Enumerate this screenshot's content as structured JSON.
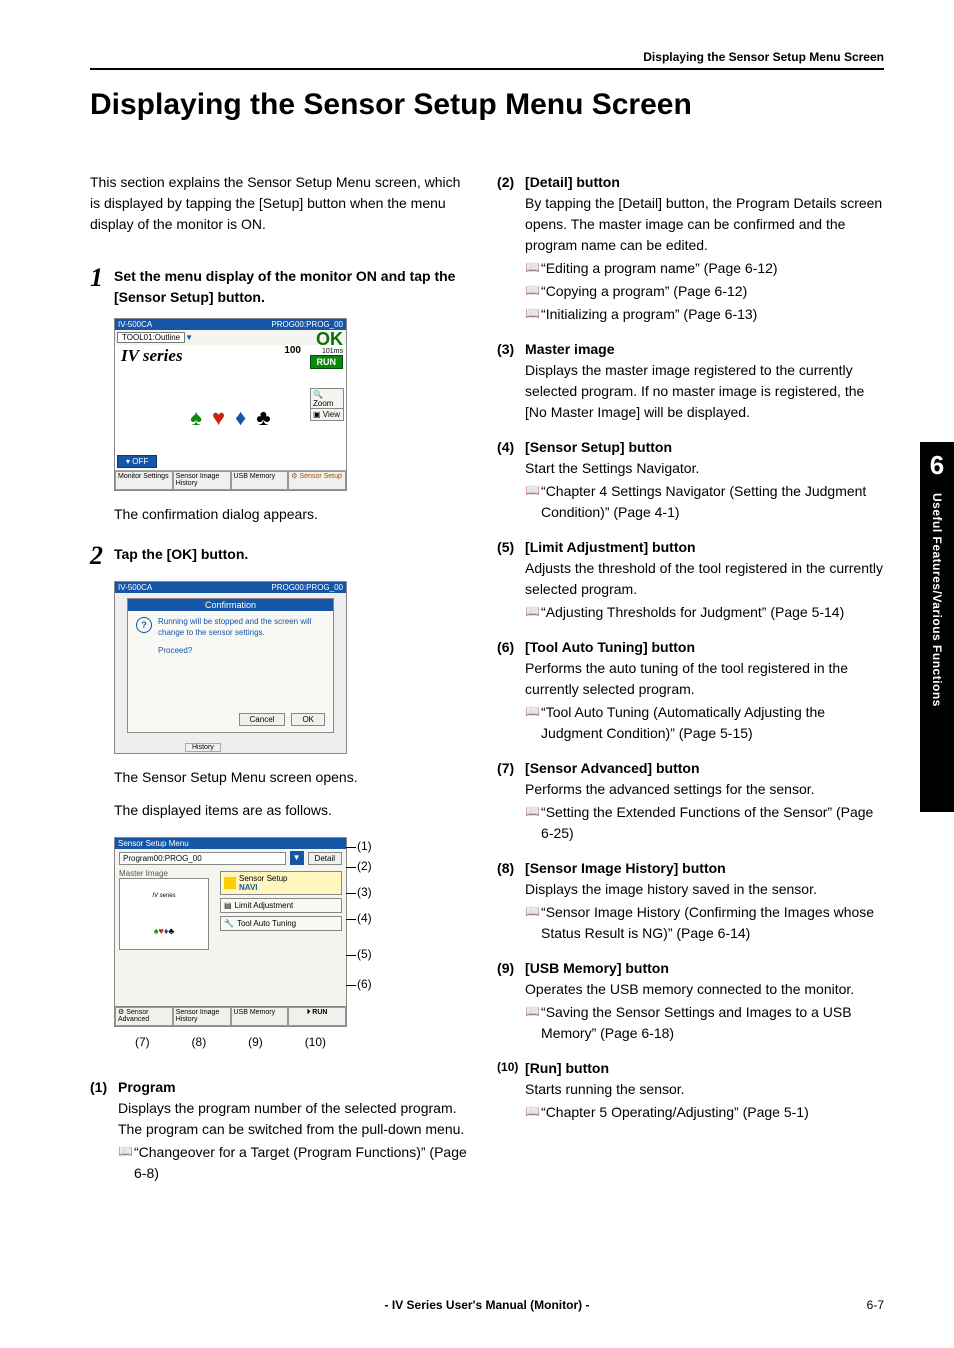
{
  "header": {
    "breadcrumb": "Displaying the Sensor Setup Menu Screen"
  },
  "title": "Displaying the Sensor Setup Menu Screen",
  "intro": "This section explains the Sensor Setup Menu screen, which is displayed by tapping the [Setup] button when the menu display of the monitor is ON.",
  "steps": {
    "1": {
      "num": "1",
      "title": "Set the menu display of the monitor ON and tap the [Sensor Setup] button.",
      "caption": "The confirmation dialog appears."
    },
    "2": {
      "num": "2",
      "title": "Tap the [OK] button.",
      "caption1": "The Sensor Setup Menu screen opens.",
      "caption2": "The displayed items are as follows."
    }
  },
  "dev1": {
    "bar_left": "IV-500CA",
    "bar_right": "PROG00:PROG_00",
    "tool": "TOOL01:Outline",
    "score": "100",
    "ok": "OK",
    "time": "101ms",
    "run": "RUN",
    "iv": "IV series",
    "zoom": "Zoom",
    "view": "View",
    "off": "OFF",
    "btn_monitor": "Monitor Settings",
    "btn_history": "Sensor Image History",
    "btn_usb": "USB Memory",
    "btn_setup": "Sensor Setup"
  },
  "dialog": {
    "bar_left": "IV-500CA",
    "bar_right": "PROG00:PROG_00",
    "title": "Confirmation",
    "text": "Running will be stopped and the screen will change to the sensor settings.",
    "proceed": "Proceed?",
    "cancel": "Cancel",
    "ok": "OK",
    "history": "History"
  },
  "ssm": {
    "bar": "Sensor Setup Menu",
    "prog": "Program00:PROG_00",
    "detail": "Detail",
    "master": "Master Image",
    "iv": "IV series",
    "navi": "Sensor Setup",
    "navi_sub": "NAVI",
    "limit": "Limit Adjustment",
    "auto": "Tool Auto Tuning",
    "btn_adv": "Sensor Advanced",
    "btn_hist": "Sensor Image History",
    "btn_usb": "USB Memory",
    "btn_run": "RUN"
  },
  "callouts": {
    "c1": "(1)",
    "c2": "(2)",
    "c3": "(3)",
    "c4": "(4)",
    "c5": "(5)",
    "c6": "(6)",
    "c7": "(7)",
    "c8": "(8)",
    "c9": "(9)",
    "c10": "(10)"
  },
  "items": {
    "i1": {
      "num": "(1)",
      "title": "Program",
      "body": "Displays the program number of the selected program. The program can be switched from the pull-down menu.",
      "ref": "“Changeover for a Target (Program Functions)” (Page 6-8)"
    },
    "i2": {
      "num": "(2)",
      "title": "[Detail] button",
      "body": "By tapping the [Detail] button, the Program Details screen opens. The master image can be confirmed and the program name can be edited.",
      "r1": "“Editing a program name” (Page 6-12)",
      "r2": "“Copying a program” (Page 6-12)",
      "r3": "“Initializing a program” (Page 6-13)"
    },
    "i3": {
      "num": "(3)",
      "title": "Master image",
      "body": "Displays the master image registered to the currently selected program. If no master image is registered, the [No Master Image] will be displayed."
    },
    "i4": {
      "num": "(4)",
      "title": "[Sensor Setup] button",
      "body": "Start the Settings Navigator.",
      "ref": "“Chapter 4  Settings Navigator (Setting the Judgment Condition)” (Page 4-1)"
    },
    "i5": {
      "num": "(5)",
      "title": "[Limit Adjustment] button",
      "body": "Adjusts the threshold of the tool registered in the currently selected program.",
      "ref": "“Adjusting Thresholds for Judgment” (Page 5-14)"
    },
    "i6": {
      "num": "(6)",
      "title": "[Tool Auto Tuning] button",
      "body": "Performs the auto tuning of the tool registered in the currently selected program.",
      "ref": "“Tool Auto Tuning (Automatically Adjusting the Judgment Condition)” (Page 5-15)"
    },
    "i7": {
      "num": "(7)",
      "title": "[Sensor Advanced] button",
      "body": "Performs the advanced settings for the sensor.",
      "ref": "“Setting the Extended Functions of the Sensor” (Page 6-25)"
    },
    "i8": {
      "num": "(8)",
      "title": "[Sensor Image History] button",
      "body": "Displays the image history saved in the sensor.",
      "ref": "“Sensor Image History (Confirming the Images whose Status Result is NG)” (Page 6-14)"
    },
    "i9": {
      "num": "(9)",
      "title": "[USB Memory] button",
      "body": "Operates the USB memory connected to the monitor.",
      "ref": "“Saving the Sensor Settings and Images to a USB Memory” (Page 6-18)"
    },
    "i10": {
      "num": "(10)",
      "title": "[Run] button",
      "body": "Starts running the sensor.",
      "ref": "“Chapter 5  Operating/Adjusting” (Page 5-1)"
    }
  },
  "sidetab": {
    "num": "6",
    "text": "Useful Features/Various Functions"
  },
  "footer": {
    "center": "- IV Series User's Manual (Monitor) -",
    "page": "6-7"
  }
}
